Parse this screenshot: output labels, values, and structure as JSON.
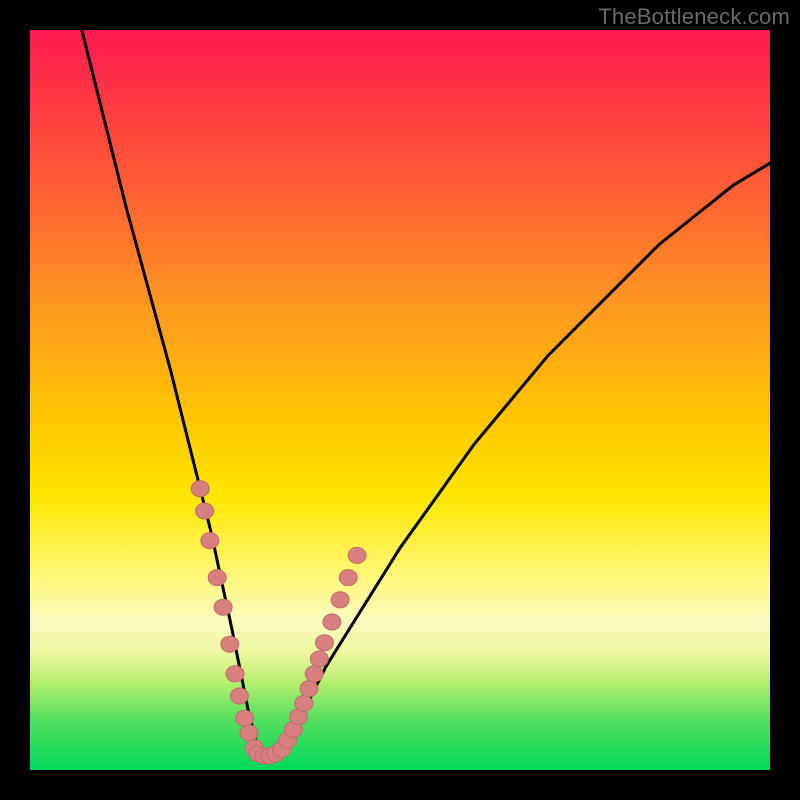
{
  "watermark": "TheBottleneck.com",
  "colors": {
    "frame": "#000000",
    "gradient_top": "#ff1a4f",
    "gradient_bottom": "#00d85a",
    "curve": "#000000",
    "dots": "#d88080"
  },
  "chart_data": {
    "type": "line",
    "title": "",
    "xlabel": "",
    "ylabel": "",
    "xlim": [
      0,
      100
    ],
    "ylim": [
      0,
      100
    ],
    "series": [
      {
        "name": "bottleneck-curve",
        "x": [
          7,
          10,
          13,
          16,
          19,
          21,
          23,
          24.5,
          26,
          27.3,
          28.5,
          29.5,
          30.5,
          31.5,
          33,
          35,
          37,
          40,
          45,
          50,
          55,
          60,
          65,
          70,
          75,
          80,
          85,
          90,
          95,
          100
        ],
        "y": [
          100,
          88,
          76,
          65,
          54,
          46,
          38,
          32,
          25,
          19,
          13,
          8,
          4,
          2,
          2,
          4,
          8,
          14,
          22,
          30,
          37,
          44,
          50,
          56,
          61,
          66,
          71,
          75,
          79,
          82
        ]
      }
    ],
    "scatter": [
      {
        "name": "left-cluster",
        "points": [
          {
            "x": 23.0,
            "y": 38
          },
          {
            "x": 23.6,
            "y": 35
          },
          {
            "x": 24.3,
            "y": 31
          },
          {
            "x": 25.3,
            "y": 26
          },
          {
            "x": 26.1,
            "y": 22
          },
          {
            "x": 27.0,
            "y": 17
          },
          {
            "x": 27.7,
            "y": 13
          },
          {
            "x": 28.3,
            "y": 10
          },
          {
            "x": 29.0,
            "y": 7
          },
          {
            "x": 29.6,
            "y": 5
          },
          {
            "x": 30.3,
            "y": 3
          }
        ]
      },
      {
        "name": "bottom-cluster",
        "points": [
          {
            "x": 30.8,
            "y": 2.2
          },
          {
            "x": 31.6,
            "y": 1.9
          },
          {
            "x": 32.4,
            "y": 1.9
          },
          {
            "x": 33.2,
            "y": 2.2
          },
          {
            "x": 34.0,
            "y": 2.8
          }
        ]
      },
      {
        "name": "right-cluster",
        "points": [
          {
            "x": 34.8,
            "y": 4.0
          },
          {
            "x": 35.6,
            "y": 5.5
          },
          {
            "x": 36.3,
            "y": 7.2
          },
          {
            "x": 37.0,
            "y": 9.0
          },
          {
            "x": 37.7,
            "y": 11.0
          },
          {
            "x": 38.4,
            "y": 13.0
          },
          {
            "x": 39.1,
            "y": 15.0
          },
          {
            "x": 39.8,
            "y": 17.2
          },
          {
            "x": 40.8,
            "y": 20.0
          },
          {
            "x": 41.9,
            "y": 23.0
          },
          {
            "x": 43.0,
            "y": 26.0
          },
          {
            "x": 44.2,
            "y": 29.0
          }
        ]
      }
    ]
  }
}
